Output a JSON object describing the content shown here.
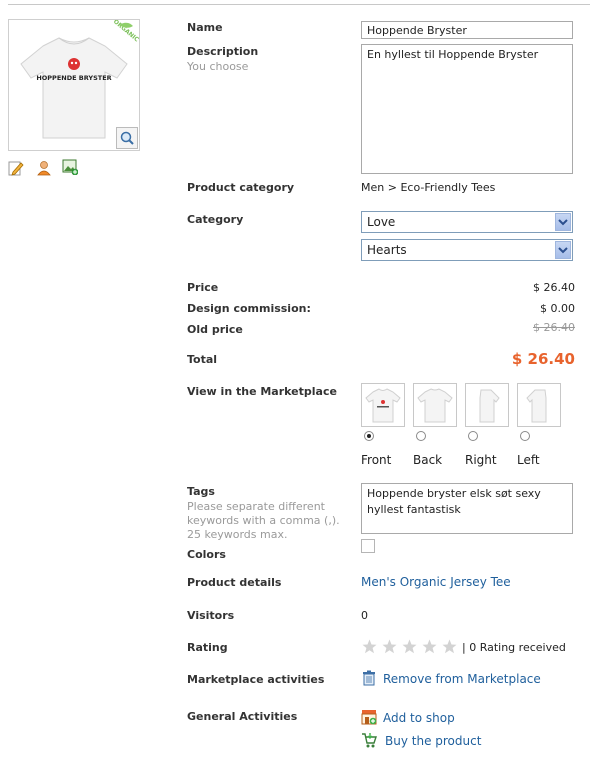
{
  "product": {
    "name_label": "Name",
    "name_value": "Hoppende Bryster",
    "description_label": "Description",
    "description_hint": "You choose",
    "description_value": "En hyllest til Hoppende Bryster",
    "shirt_print_text": "HOPPENDE BRYSTER",
    "organic_badge": "ORGANIC"
  },
  "category": {
    "product_category_label": "Product category",
    "product_category_value": "Men > Eco-Friendly Tees",
    "category_label": "Category",
    "category_1_selected": "Love",
    "category_2_selected": "Hearts"
  },
  "pricing": {
    "price_label": "Price",
    "price_value": "$ 26.40",
    "design_commission_label": "Design commission:",
    "design_commission_value": "$ 0.00",
    "old_price_label": "Old price",
    "old_price_value": "$ 26.40",
    "total_label": "Total",
    "total_value": "$ 26.40",
    "total_color": "#e8632d"
  },
  "marketplace": {
    "view_label": "View in the Marketplace",
    "views": [
      {
        "label": "Front",
        "selected": true
      },
      {
        "label": "Back",
        "selected": false
      },
      {
        "label": "Right",
        "selected": false
      },
      {
        "label": "Left",
        "selected": false
      }
    ]
  },
  "tags": {
    "label": "Tags",
    "hint": "Please separate different keywords with a comma (,). 25 keywords max.",
    "value": "Hoppende bryster elsk søt sexy hyllest fantastisk"
  },
  "colors": {
    "label": "Colors"
  },
  "details": {
    "product_details_label": "Product details",
    "product_details_link": "Men's Organic Jersey Tee",
    "visitors_label": "Visitors",
    "visitors_value": "0",
    "rating_label": "Rating",
    "rating_stars": 0,
    "rating_text": "| 0 Rating received",
    "marketplace_activities_label": "Marketplace activities",
    "remove_link": "Remove from Marketplace",
    "general_activities_label": "General Activities",
    "add_to_shop_link": "Add to shop",
    "buy_product_link": "Buy the product"
  },
  "icons": {
    "edit": "pencil-icon",
    "user": "user-icon",
    "image_add": "image-add-icon",
    "zoom": "magnifier-icon",
    "trash": "trash-icon",
    "shop": "shop-icon",
    "cart": "cart-icon"
  }
}
